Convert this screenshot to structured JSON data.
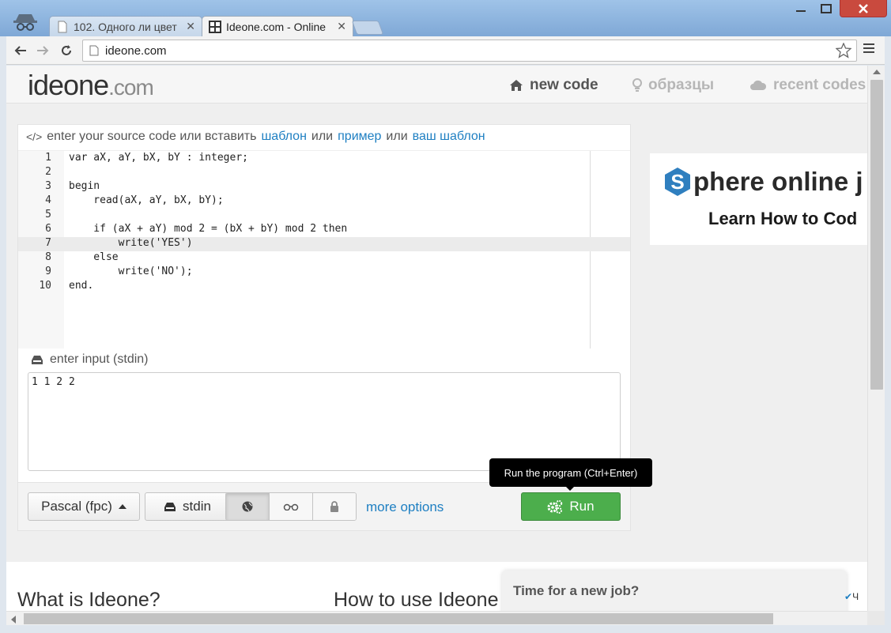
{
  "browser": {
    "tabs": [
      {
        "title": "102. Одного ли цвет",
        "close": "✕"
      },
      {
        "title": "Ideone.com - Online",
        "close": "✕"
      }
    ],
    "url": "ideone.com"
  },
  "site": {
    "logo_main": "ideone",
    "logo_suffix": ".com",
    "nav": {
      "new_code": "new code",
      "samples": "образцы",
      "recent": "recent codes"
    }
  },
  "editor": {
    "heading_prefix": "</>",
    "heading_text": "enter your source code или вставить",
    "link_template": "шаблон",
    "or_1": "или",
    "link_example": "пример",
    "or_2": "или",
    "link_your_template": "ваш шаблон",
    "current_line": 7,
    "lines": [
      "var aX, aY, bX, bY : integer;",
      "",
      "begin",
      "    read(aX, aY, bX, bY);",
      "",
      "    if (aX + aY) mod 2 = (bX + bY) mod 2 then",
      "        write('YES')",
      "    else",
      "        write('NO');",
      "end."
    ]
  },
  "input": {
    "heading": "enter input (stdin)",
    "value": "1 1 2 2"
  },
  "footer": {
    "language": "Pascal (fpc)",
    "stdin_btn": "stdin",
    "more_options": "more options",
    "run": "Run",
    "tooltip": "Run the program (Ctrl+Enter)"
  },
  "ad": {
    "brand": "phere online j",
    "tagline": "Learn How to Cod"
  },
  "info": {
    "what_is": "What is Ideone?",
    "how_to": "How to use Ideone",
    "job_popup": "Time for a new job?",
    "lang_corner": "Ч"
  }
}
